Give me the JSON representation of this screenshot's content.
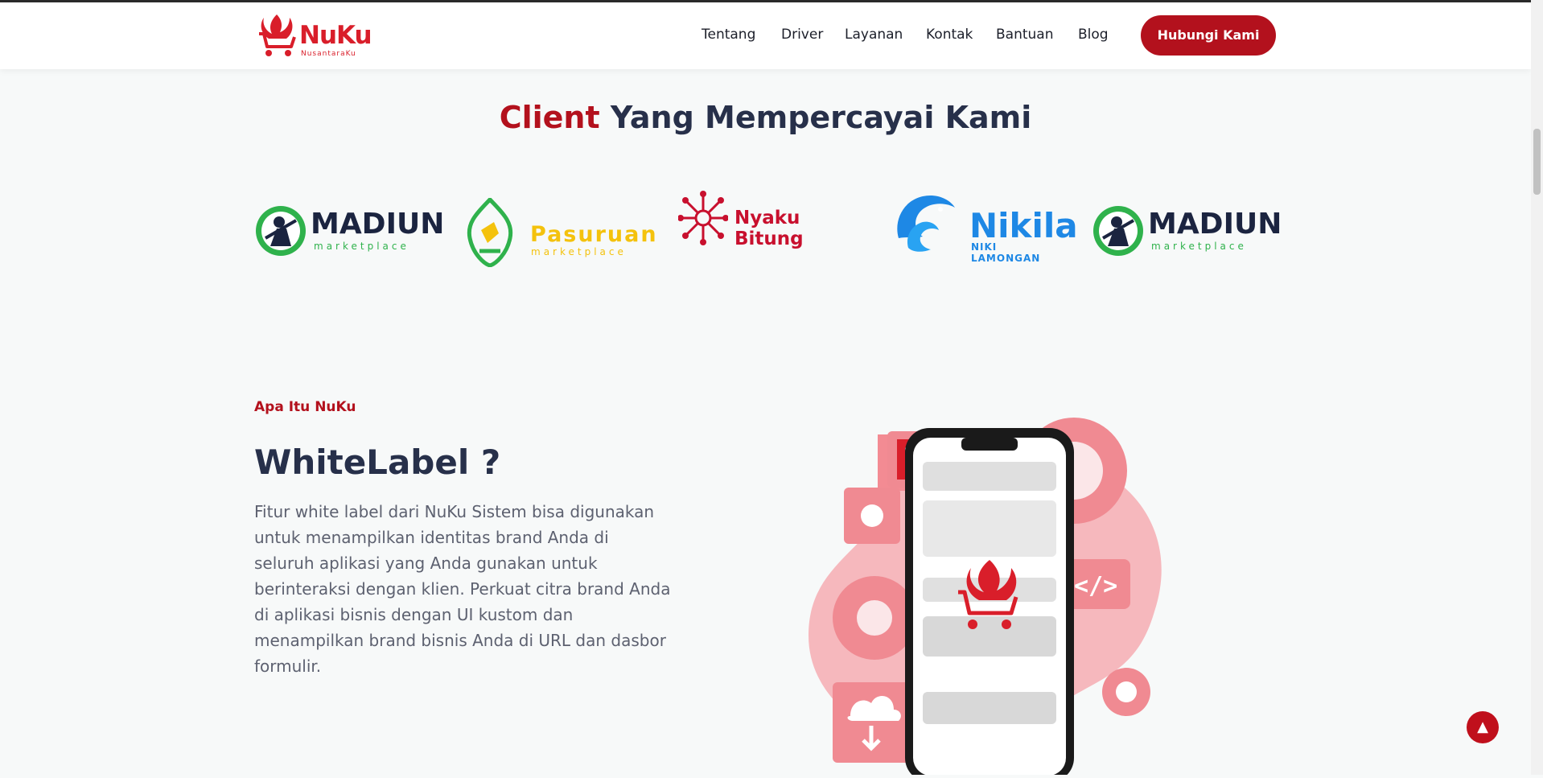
{
  "brand": {
    "name": "NuKu",
    "tagline": "NusantaraKu",
    "color": "#d91e2a"
  },
  "nav": {
    "items": [
      "Tentang",
      "Driver",
      "Layanan",
      "Kontak",
      "Bantuan",
      "Blog"
    ],
    "cta_label": "Hubungi Kami"
  },
  "clients": {
    "title_accent": "Client",
    "title_rest": "Yang Mempercayai Kami",
    "logos": [
      {
        "name": "MADIUN",
        "sub": "marketplace"
      },
      {
        "name": "Pasuruan",
        "sub": "marketplace"
      },
      {
        "name": "Nyaku Bitung",
        "sub": ""
      },
      {
        "name": "Nikila",
        "sub": "NIKI LAMONGAN"
      },
      {
        "name": "MADIUN",
        "sub": "marketplace"
      }
    ]
  },
  "about": {
    "eyebrow": "Apa Itu NuKu",
    "title": "WhiteLabel ?",
    "description": "Fitur white label dari NuKu Sistem bisa digunakan untuk menampilkan identitas brand Anda di seluruh aplikasi yang Anda gunakan untuk berinteraksi dengan klien. Perkuat citra brand Anda di aplikasi bisnis dengan UI kustom dan menampilkan brand bisnis Anda di URL dan dasbor formulir."
  },
  "icons": {
    "logo": "nuku-logo-icon",
    "scroll_top": "chevron-up-icon"
  },
  "colors": {
    "primary": "#b3111d",
    "heading": "#27304a",
    "text": "#5d6170"
  }
}
